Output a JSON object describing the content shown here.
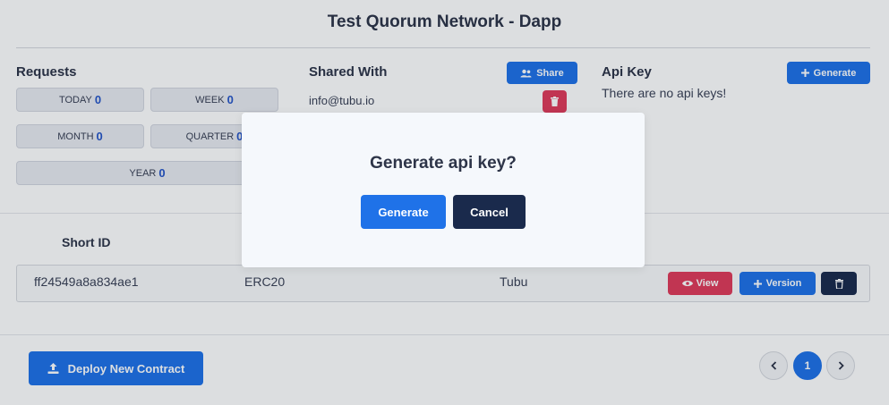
{
  "page": {
    "title": "Test Quorum Network - Dapp"
  },
  "requests": {
    "title": "Requests",
    "stats": [
      {
        "label": "TODAY",
        "value": "0"
      },
      {
        "label": "WEEK",
        "value": "0"
      },
      {
        "label": "MONTH",
        "value": "0"
      },
      {
        "label": "QUARTER",
        "value": "0"
      },
      {
        "label": "YEAR",
        "value": "0"
      }
    ]
  },
  "shared": {
    "title": "Shared With",
    "share_label": "Share",
    "emails": [
      "info@tubu.io"
    ]
  },
  "apikey": {
    "title": "Api Key",
    "generate_label": "Generate",
    "empty_text": "There are no api keys!"
  },
  "table": {
    "headers": [
      "Short ID"
    ],
    "rows": [
      {
        "short_id": "ff24549a8a834ae1",
        "type": "ERC20",
        "owner": "Tubu"
      }
    ],
    "actions": {
      "view": "View",
      "version": "Version"
    }
  },
  "footer": {
    "deploy_label": "Deploy New Contract"
  },
  "pagination": {
    "current": "1",
    "prev_icon": "chevron-left-icon",
    "next_icon": "chevron-right-icon"
  },
  "modal": {
    "title": "Generate api key?",
    "confirm_label": "Generate",
    "cancel_label": "Cancel"
  },
  "colors": {
    "primary": "#1f72e8",
    "danger": "#e03b5a",
    "dark": "#1a2a4c"
  }
}
